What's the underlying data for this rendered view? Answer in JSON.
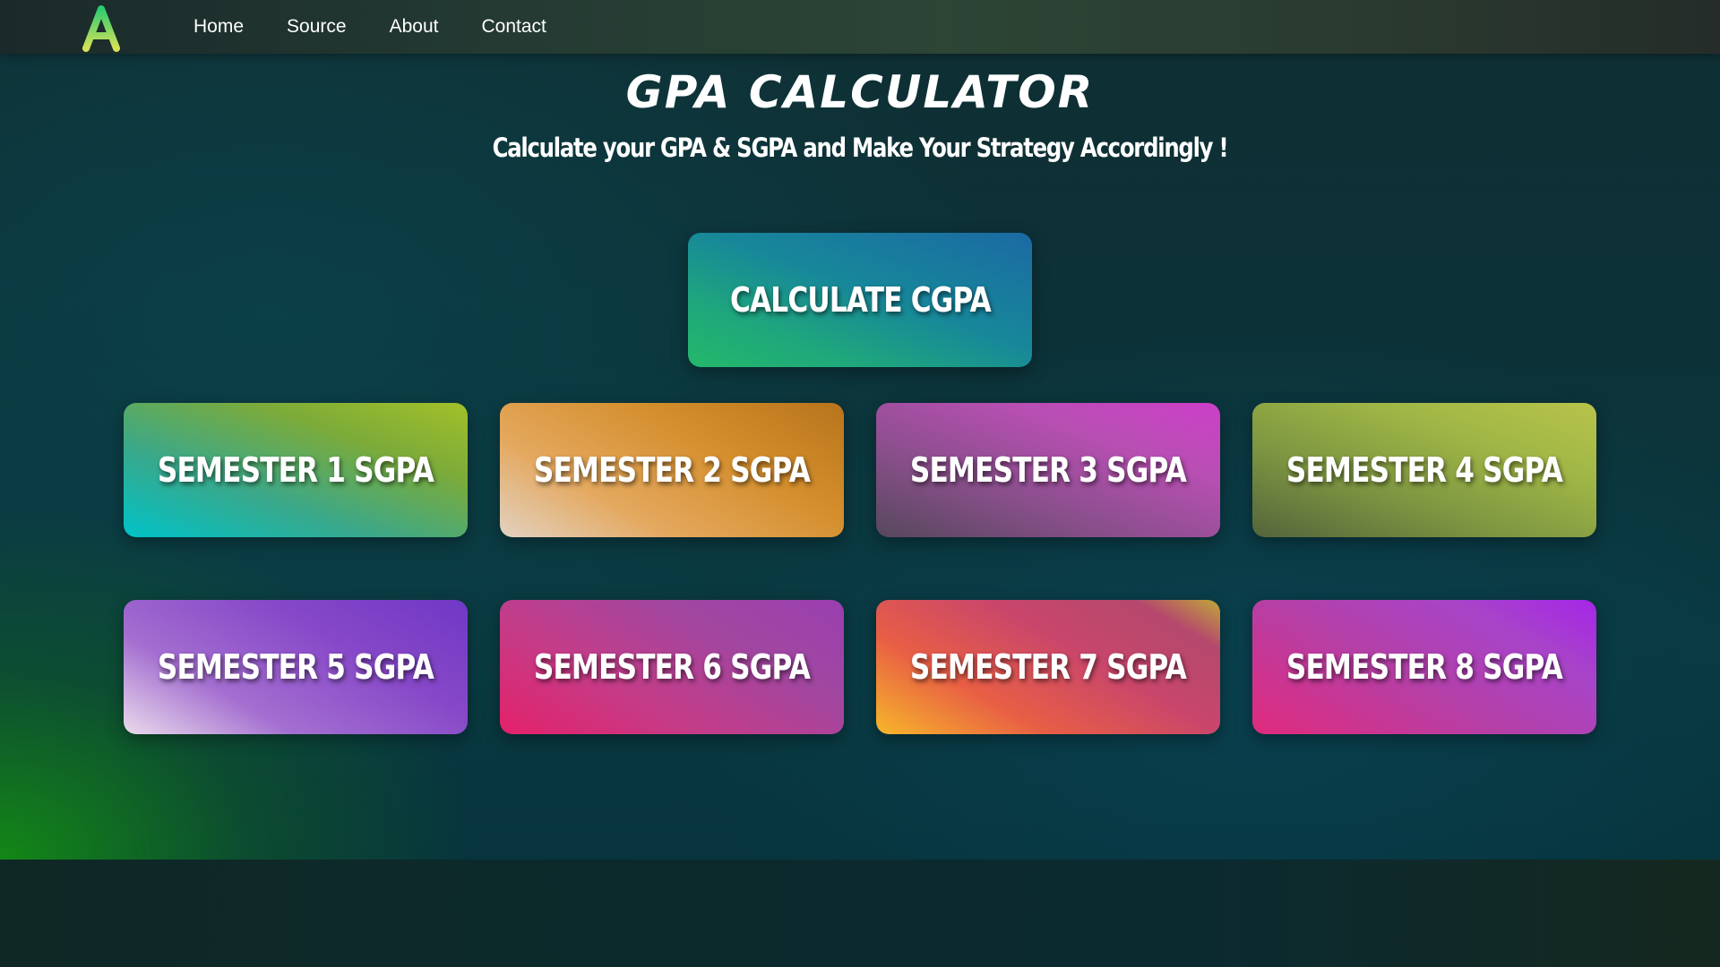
{
  "nav": {
    "logo_letter": "A",
    "links": [
      "Home",
      "Source",
      "About",
      "Contact"
    ]
  },
  "header": {
    "title": "GPA CALCULATOR",
    "subtitle": "Calculate your GPA & SGPA and Make Your Strategy Accordingly !"
  },
  "buttons": {
    "cgpa": "CALCULATE CGPA",
    "semesters": [
      "SEMESTER 1 SGPA",
      "SEMESTER 2 SGPA",
      "SEMESTER 3 SGPA",
      "SEMESTER 4 SGPA",
      "SEMESTER 5 SGPA",
      "SEMESTER 6 SGPA",
      "SEMESTER 7 SGPA",
      "SEMESTER 8 SGPA"
    ]
  },
  "colors": {
    "logo_gradient": [
      "#2ecc71",
      "#d4e157"
    ],
    "text": "#ffffff"
  }
}
